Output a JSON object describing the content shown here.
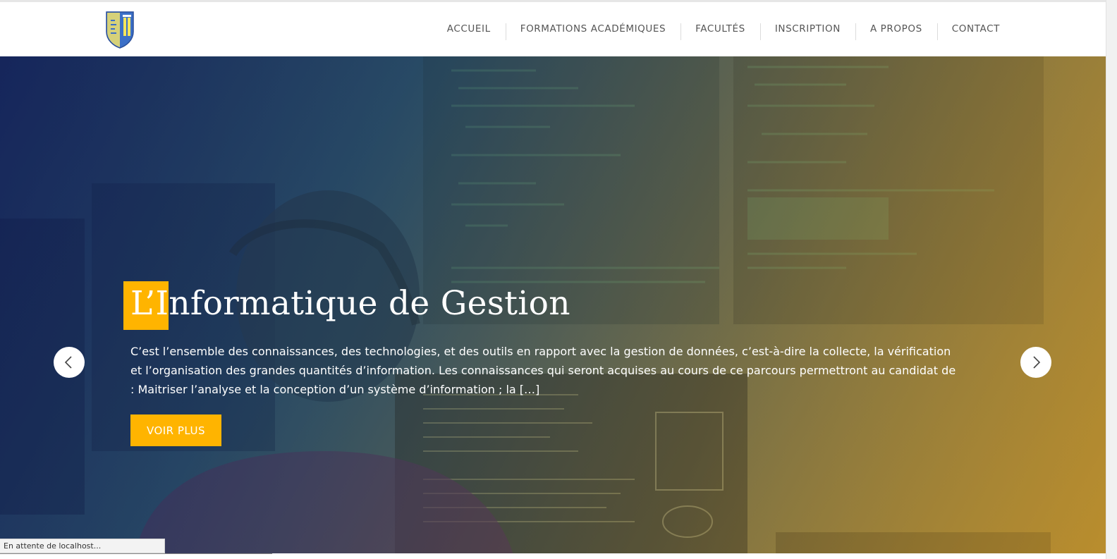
{
  "header": {
    "logo_alt": "ISIPA",
    "nav": [
      {
        "label": "ACCUEIL"
      },
      {
        "label": "FORMATIONS ACADÉMIQUES"
      },
      {
        "label": "FACULTÉS"
      },
      {
        "label": "INSCRIPTION"
      },
      {
        "label": "A PROPOS"
      },
      {
        "label": "CONTACT"
      }
    ]
  },
  "hero": {
    "title": "L’Informatique de Gestion",
    "description": "C’est l’ensemble des connaissances, des technologies, et des outils en rapport avec la gestion de données, c’est-à-dire la collecte, la vérification et l’organisation des grandes quantités d’information. Les connaissances qui seront acquises au cours de ce parcours permettront au candidat de : Maitriser l’analyse et la conception d’un système d’information ; la […]",
    "button_label": "VOIR PLUS",
    "prev_icon": "chevron-left-icon",
    "next_icon": "chevron-right-icon"
  },
  "status": {
    "text": "En attente de localhost..."
  },
  "colors": {
    "accent": "#ffb400",
    "nav_text": "#555555"
  }
}
